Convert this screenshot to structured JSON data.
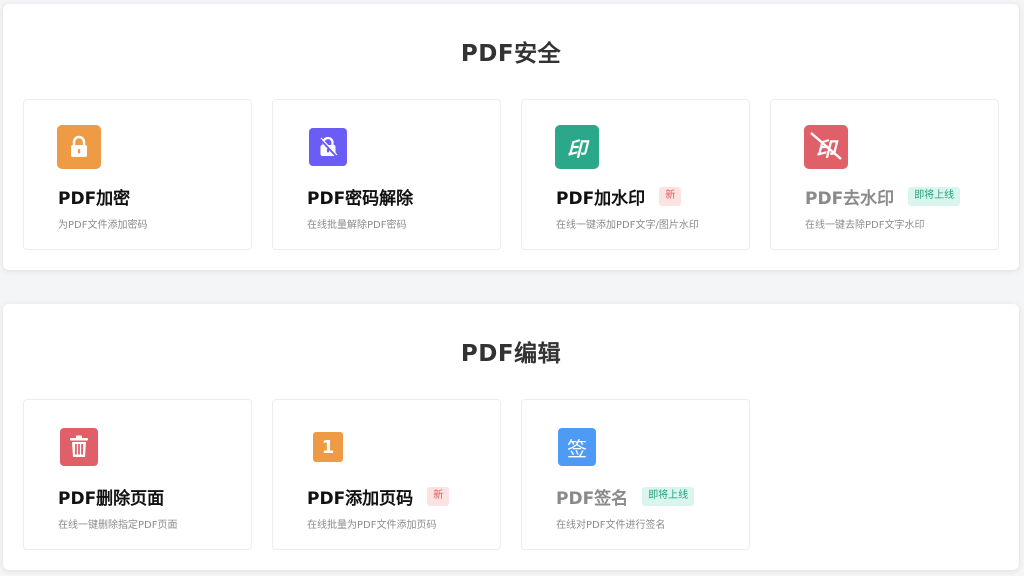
{
  "colors": {
    "orange": "#ef9a45",
    "purple": "#6b5cf6",
    "teal": "#2aa889",
    "red": "#e0606a",
    "blue": "#4d9bf5",
    "badge_new_bg": "#fde2e2",
    "badge_soon_bg": "#d9f5ee"
  },
  "sections": [
    {
      "title": "PDF安全",
      "cards": [
        {
          "icon": "lock-icon",
          "title": "PDF加密",
          "badge": "",
          "desc": "为PDF文件添加密码"
        },
        {
          "icon": "unlock-icon",
          "title": "PDF密码解除",
          "badge": "",
          "desc": "在线批量解除PDF密码"
        },
        {
          "icon": "stamp-icon",
          "title": "PDF加水印",
          "badge": "新",
          "desc": "在线一键添加PDF文字/图片水印"
        },
        {
          "icon": "stamp-remove-icon",
          "title": "PDF去水印",
          "badge": "即将上线",
          "desc": "在线一键去除PDF文字水印"
        }
      ]
    },
    {
      "title": "PDF编辑",
      "cards": [
        {
          "icon": "trash-icon",
          "title": "PDF删除页面",
          "badge": "",
          "desc": "在线一键删除指定PDF页面"
        },
        {
          "icon": "page-number-icon",
          "title": "PDF添加页码",
          "badge": "新",
          "desc": "在线批量为PDF文件添加页码"
        },
        {
          "icon": "signature-icon",
          "title": "PDF签名",
          "badge": "即将上线",
          "desc": "在线对PDF文件进行签名"
        }
      ]
    }
  ],
  "icon_glyphs": {
    "stamp": "印",
    "page_number": "1",
    "signature": "签"
  }
}
